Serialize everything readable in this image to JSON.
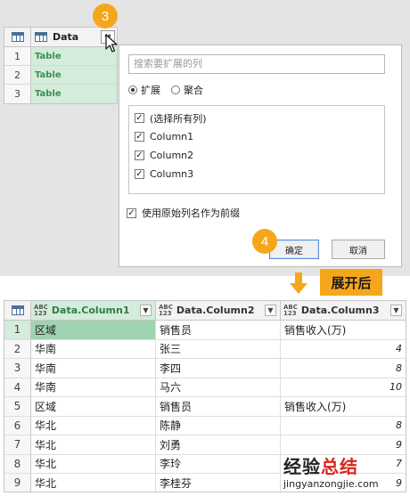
{
  "source_table": {
    "column_header": "Data",
    "rows": [
      {
        "index": "1",
        "value": "Table"
      },
      {
        "index": "2",
        "value": "Table"
      },
      {
        "index": "3",
        "value": "Table"
      }
    ]
  },
  "steps": {
    "step3": "3",
    "step4": "4"
  },
  "expand_popup": {
    "search_placeholder": "搜索要扩展的列",
    "mode_expand": "扩展",
    "mode_aggregate": "聚合",
    "columns": [
      {
        "label": "(选择所有列)",
        "checked": true
      },
      {
        "label": "Column1",
        "checked": true
      },
      {
        "label": "Column2",
        "checked": true
      },
      {
        "label": "Column3",
        "checked": true
      }
    ],
    "prefix_option": "使用原始列名作为前缀",
    "ok_label": "确定",
    "cancel_label": "取消"
  },
  "after_label": "展开后",
  "result_table": {
    "type_badge_top": "ABC",
    "type_badge_bottom": "123",
    "headers": [
      "Data.Column1",
      "Data.Column2",
      "Data.Column3"
    ],
    "rows": [
      {
        "index": "1",
        "cells": [
          "区域",
          "销售员",
          "销售收入(万)"
        ]
      },
      {
        "index": "2",
        "cells": [
          "华南",
          "张三",
          "4"
        ]
      },
      {
        "index": "3",
        "cells": [
          "华南",
          "李四",
          "8"
        ]
      },
      {
        "index": "4",
        "cells": [
          "华南",
          "马六",
          "10"
        ]
      },
      {
        "index": "5",
        "cells": [
          "区域",
          "销售员",
          "销售收入(万)"
        ]
      },
      {
        "index": "6",
        "cells": [
          "华北",
          "陈静",
          "8"
        ]
      },
      {
        "index": "7",
        "cells": [
          "华北",
          "刘勇",
          "9"
        ]
      },
      {
        "index": "8",
        "cells": [
          "华北",
          "李玲",
          "7"
        ]
      },
      {
        "index": "9",
        "cells": [
          "华北",
          "李桂芬",
          "9"
        ]
      }
    ]
  },
  "watermark": {
    "title_black": "经验",
    "title_red": "总结",
    "url": "jingyanzongjie.com"
  },
  "colors": {
    "accent_orange": "#f5a61b",
    "selection_green": "#d4ecdb",
    "watermark_red": "#d9261c"
  }
}
